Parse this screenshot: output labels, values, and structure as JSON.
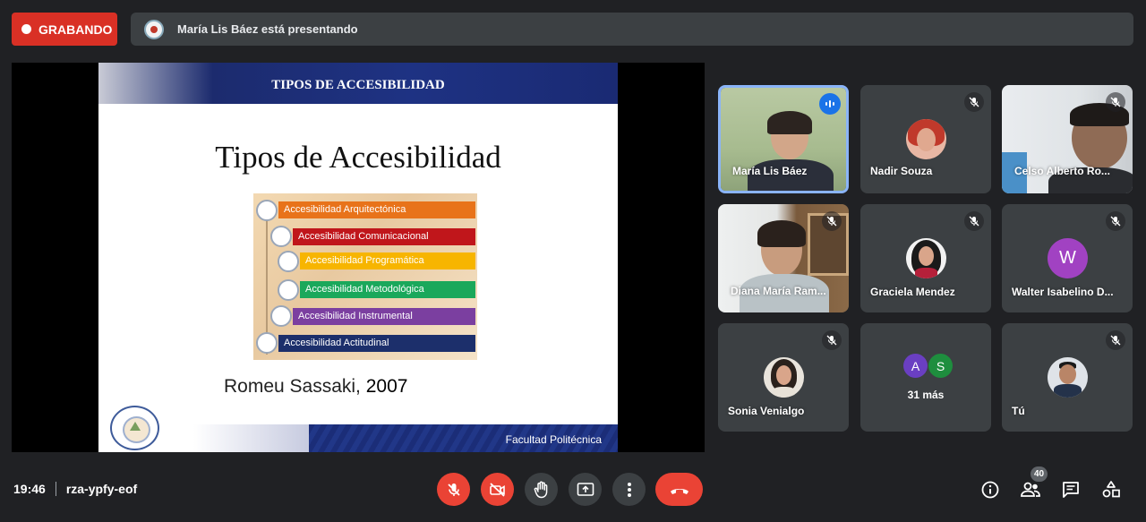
{
  "top_bar": {
    "recording_label": "GRABANDO",
    "presenting_text": "María Lis Báez está presentando"
  },
  "slide": {
    "header": "TIPOS DE ACCESIBILIDAD",
    "title": "Tipos de Accesibilidad",
    "items": [
      {
        "label": "Accesibilidad Arquitectónica",
        "color": "#e8731a"
      },
      {
        "label": "Accesibilidad Comunicacional",
        "color": "#c0161b"
      },
      {
        "label": "Accesibilidad Programática",
        "color": "#f7b500"
      },
      {
        "label": "Accesibilidad  Metodológica",
        "color": "#1aa85b"
      },
      {
        "label": "Accesibilidad Instrumental",
        "color": "#7b3fa0"
      },
      {
        "label": "Accesibilidad Actitudinal",
        "color": "#1c2f6b"
      }
    ],
    "author": "Romeu Sassaki,",
    "year": "2007",
    "footer": "Facultad Politécnica"
  },
  "participants": [
    {
      "name": "María Lis Báez",
      "type": "video",
      "status": "speaking"
    },
    {
      "name": "Nadir Souza",
      "type": "photo",
      "status": "muted"
    },
    {
      "name": "Celso Alberto Ro...",
      "type": "video",
      "status": "muted"
    },
    {
      "name": "Diana María Ram...",
      "type": "video",
      "status": "muted"
    },
    {
      "name": "Graciela Mendez",
      "type": "photo",
      "status": "muted"
    },
    {
      "name": "Walter Isabelino D...",
      "type": "letter",
      "letter": "W",
      "color": "#a142c2",
      "status": "muted"
    },
    {
      "name": "Sonia Venialgo",
      "type": "photo",
      "status": "muted"
    },
    {
      "name": "31 más",
      "type": "more",
      "letters": [
        "A",
        "S"
      ],
      "colors": [
        "#6a3fc2",
        "#1e8e3e"
      ]
    },
    {
      "name": "Tú",
      "type": "photo",
      "status": "muted"
    }
  ],
  "bottom_bar": {
    "time": "19:46",
    "meeting_code": "rza-ypfy-eof",
    "participant_count": "40"
  },
  "controls": [
    "mic-off-icon",
    "camera-off-icon",
    "raise-hand-icon",
    "present-icon",
    "more-options-icon",
    "end-call-icon"
  ],
  "right_icons": [
    "info-icon",
    "people-icon",
    "chat-icon",
    "activities-icon"
  ]
}
